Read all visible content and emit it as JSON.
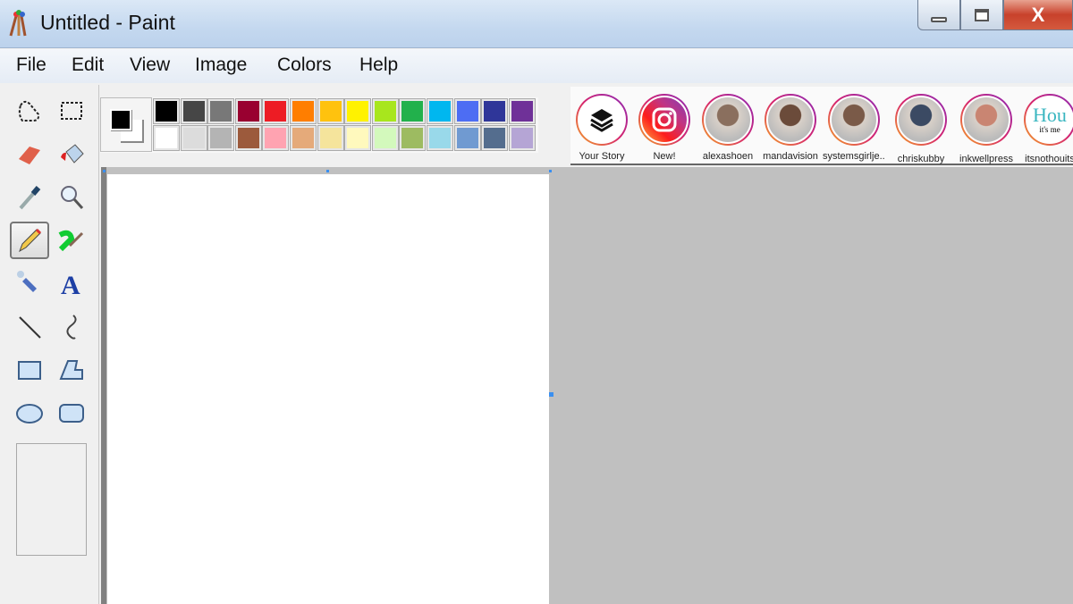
{
  "window": {
    "title": "Untitled - Paint",
    "close_glyph": "X"
  },
  "menu": [
    "File",
    "Edit",
    "View",
    "Image",
    "Colors",
    "Help"
  ],
  "tools": [
    {
      "name": "free-form-select",
      "icon": "lasso-icon"
    },
    {
      "name": "rectangle-select",
      "icon": "rect-select-icon"
    },
    {
      "name": "eraser",
      "icon": "eraser-icon"
    },
    {
      "name": "fill",
      "icon": "paint-bucket-icon"
    },
    {
      "name": "pick-color",
      "icon": "eyedropper-icon"
    },
    {
      "name": "magnifier",
      "icon": "magnifier-icon"
    },
    {
      "name": "pencil",
      "icon": "pencil-icon",
      "selected": true
    },
    {
      "name": "brush",
      "icon": "brush-icon"
    },
    {
      "name": "airbrush",
      "icon": "airbrush-icon"
    },
    {
      "name": "text",
      "icon": "text-icon",
      "glyph": "A"
    },
    {
      "name": "line",
      "icon": "line-icon"
    },
    {
      "name": "curve",
      "icon": "curve-icon"
    },
    {
      "name": "rectangle",
      "icon": "rectangle-icon"
    },
    {
      "name": "polygon",
      "icon": "polygon-icon"
    },
    {
      "name": "ellipse",
      "icon": "ellipse-icon"
    },
    {
      "name": "rounded-rectangle",
      "icon": "rounded-rect-icon"
    }
  ],
  "colors": {
    "foreground": "#000000",
    "background": "#ffffff"
  },
  "palette": [
    [
      "#000000",
      "#464646",
      "#787878",
      "#990030",
      "#ed1c24",
      "#ff7e00",
      "#ffc20e",
      "#fff200",
      "#a8e61d",
      "#22b14c",
      "#00b7ef",
      "#4d6df3",
      "#2f3699",
      "#6f3198"
    ],
    [
      "#ffffff",
      "#dcdcdc",
      "#b4b4b4",
      "#9c5a3c",
      "#ffa3b1",
      "#e5aa7a",
      "#f5e49c",
      "#fff9bd",
      "#d3f9bc",
      "#9dbb61",
      "#99d9ea",
      "#709ad1",
      "#546d8e",
      "#b5a5d5"
    ]
  ],
  "stories": [
    {
      "label": "Your Story",
      "icon": "layers-icon"
    },
    {
      "label": "New!",
      "icon": "instagram-icon"
    },
    {
      "label": "alexashoen",
      "icon": "avatar",
      "color": "#8a6f5e"
    },
    {
      "label": "mandavision",
      "icon": "avatar",
      "color": "#6b4b3a"
    },
    {
      "label": "systemsgirlje...",
      "icon": "avatar",
      "color": "#7a5a48"
    },
    {
      "label": "chriskubby",
      "icon": "avatar",
      "color": "#3b4a63"
    },
    {
      "label": "inkwellpress",
      "icon": "avatar",
      "color": "#c98572"
    },
    {
      "label": "itsnothouits",
      "icon": "avatar",
      "logo_text": "it's not Hou it's me"
    }
  ]
}
